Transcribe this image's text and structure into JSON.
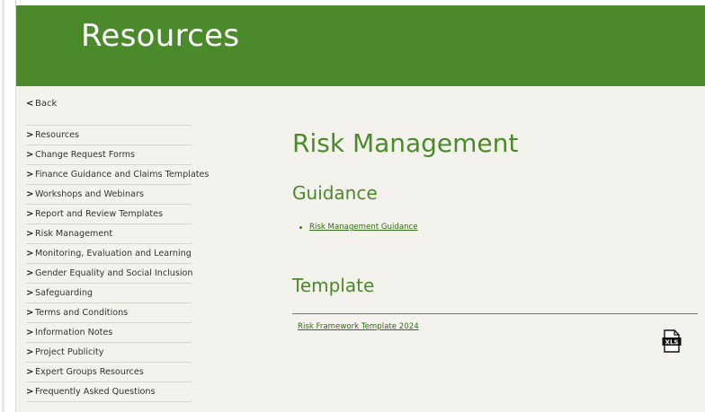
{
  "banner": {
    "title": "Resources"
  },
  "sidebar": {
    "back_label": "Back",
    "items": [
      {
        "label": "Resources"
      },
      {
        "label": "Change Request Forms"
      },
      {
        "label": "Finance Guidance and Claims Templates"
      },
      {
        "label": "Workshops and Webinars"
      },
      {
        "label": "Report and Review Templates"
      },
      {
        "label": "Risk Management"
      },
      {
        "label": "Monitoring, Evaluation and Learning"
      },
      {
        "label": "Gender Equality and Social Inclusion"
      },
      {
        "label": "Safeguarding"
      },
      {
        "label": "Terms and Conditions"
      },
      {
        "label": "Information Notes"
      },
      {
        "label": "Project Publicity"
      },
      {
        "label": "Expert Groups Resources"
      },
      {
        "label": "Frequently Asked Questions"
      }
    ]
  },
  "main": {
    "title": "Risk Management",
    "guidance": {
      "heading": "Guidance",
      "links": [
        {
          "label": "Risk Management Guidance"
        }
      ]
    },
    "template": {
      "heading": "Template",
      "file_label": "Risk Framework Template 2024",
      "file_icon": "xls-file-icon",
      "file_icon_text": "XLS"
    }
  },
  "colors": {
    "brand_green": "#4a8a2a",
    "link_green": "#2f6e14",
    "content_bg": "#f4f2ec"
  }
}
